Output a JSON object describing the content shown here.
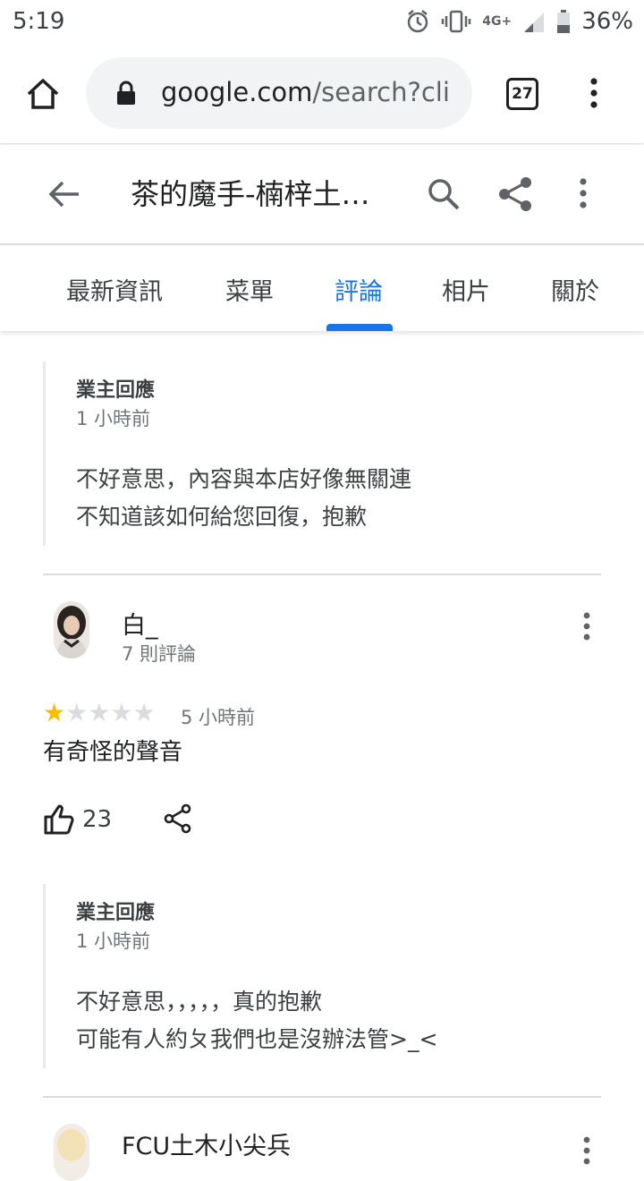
{
  "status_bar": {
    "time": "5:19",
    "network": "4G+",
    "battery": "36%"
  },
  "browser": {
    "url_domain": "google.com",
    "url_path": "/search?cli",
    "tab_count": "27"
  },
  "place": {
    "title": "茶的魔手-楠梓土…"
  },
  "tabs": [
    {
      "label": "最新資訊",
      "active": false
    },
    {
      "label": "菜單",
      "active": false
    },
    {
      "label": "評論",
      "active": true
    },
    {
      "label": "相片",
      "active": false
    },
    {
      "label": "關於",
      "active": false
    }
  ],
  "accent_color": "#1a73e8",
  "reviews": [
    {
      "owner_reply": {
        "label": "業主回應",
        "time": "1 小時前",
        "lines": [
          "不好意思，內容與本店好像無關連",
          "不知道該如何給您回復，抱歉"
        ]
      }
    },
    {
      "reviewer_name": "白_",
      "reviewer_reviews": "7 則評論",
      "rating": 1,
      "max_rating": 5,
      "time": "5 小時前",
      "text": "有奇怪的聲音",
      "likes": "23",
      "owner_reply": {
        "label": "業主回應",
        "time": "1 小時前",
        "lines": [
          "不好意思，，，，，真的抱歉",
          "可能有人約ㄆ我們也是沒辦法管>_<"
        ]
      }
    },
    {
      "reviewer_name": "FCU土木小尖兵"
    }
  ]
}
